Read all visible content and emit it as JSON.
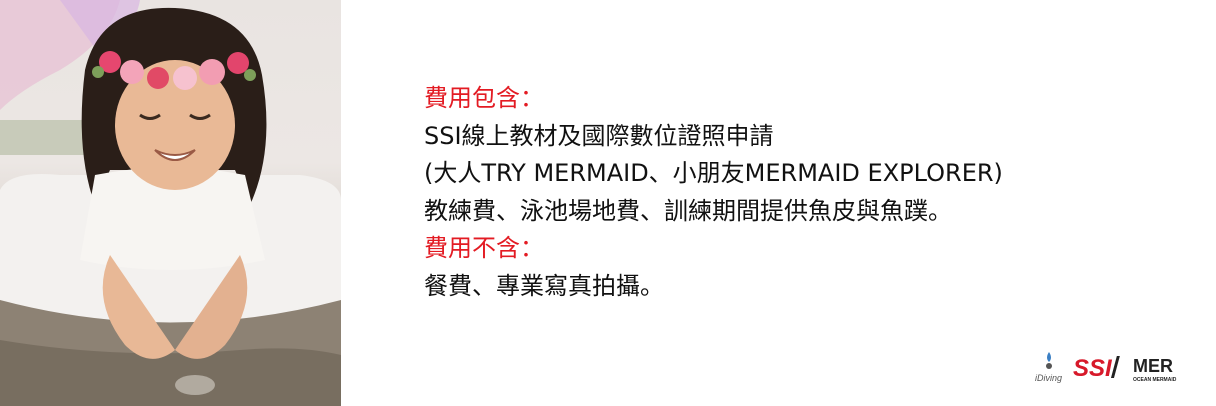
{
  "photo": {
    "alt_icon": "child-with-flower-crown-photo"
  },
  "content": {
    "included_heading": "費用包含：",
    "line1": "SSI線上教材及國際數位證照申請",
    "line2": "(大人TRY MERMAID、小朋友MERMAID EXPLORER)",
    "line3": "教練費、泳池場地費、訓練期間提供魚皮與魚蹼。",
    "excluded_heading": "費用不含：",
    "line4": "餐費、專業寫真拍攝。"
  },
  "logos": {
    "idiving": "iDiving",
    "ssi": "SSI",
    "mer": "MER",
    "mer_sub": "OCEAN MERMAID"
  },
  "colors": {
    "heading": "#e31b23",
    "body_text": "#111111",
    "ssi_red": "#d7192a"
  }
}
